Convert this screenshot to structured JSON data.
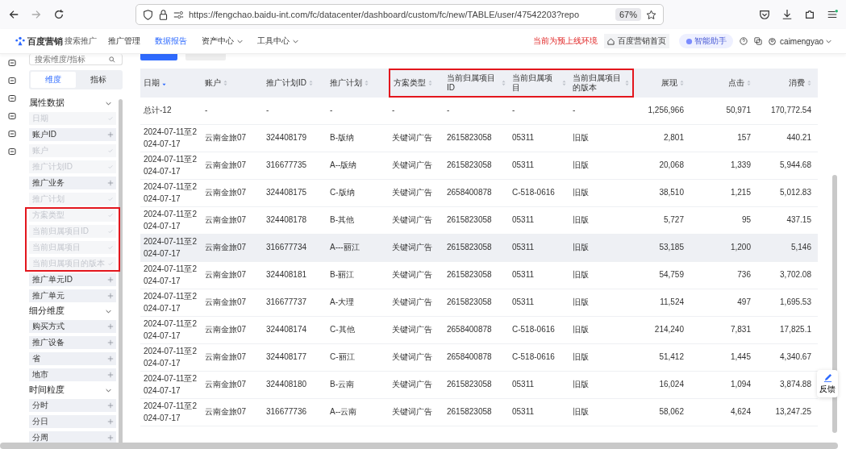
{
  "browser": {
    "url": "https://fengchao.baidu-int.com/fc/datacenter/dashboard/custom/fc/new/TABLE/user/47542203?repo",
    "zoom": "67%"
  },
  "nav": {
    "brand": "百度营销",
    "product": "搜索推广",
    "menu": [
      {
        "label": "推广管理",
        "selected": false,
        "dropdown": false
      },
      {
        "label": "数据报告",
        "selected": true,
        "dropdown": false
      },
      {
        "label": "资产中心",
        "selected": false,
        "dropdown": true
      },
      {
        "label": "工具中心",
        "selected": false,
        "dropdown": true
      }
    ],
    "env_notice": "当前为预上线环境",
    "home_link": "百度营销首页",
    "assistant": "智能助手",
    "user": "caimengyao"
  },
  "sidebar": {
    "search": {
      "placeholder": "搜索维度/指标"
    },
    "tabs": [
      {
        "label": "维度",
        "selected": true
      },
      {
        "label": "指标",
        "selected": false
      }
    ],
    "sections": [
      {
        "title": "属性数据",
        "expanded": true,
        "items": [
          {
            "label": "日期",
            "added": true,
            "highlighted": false
          },
          {
            "label": "账户ID",
            "added": false,
            "highlighted": false
          },
          {
            "label": "账户",
            "added": true,
            "highlighted": false
          },
          {
            "label": "推广计划ID",
            "added": true,
            "highlighted": false
          },
          {
            "label": "推广业务",
            "added": false,
            "highlighted": false
          },
          {
            "label": "推广计划",
            "added": true,
            "highlighted": false
          },
          {
            "label": "方案类型",
            "added": true,
            "highlighted": true
          },
          {
            "label": "当前归属项目ID",
            "added": true,
            "highlighted": true
          },
          {
            "label": "当前归属项目",
            "added": true,
            "highlighted": true
          },
          {
            "label": "当前归属项目的版本",
            "added": true,
            "highlighted": true
          },
          {
            "label": "推广单元ID",
            "added": false,
            "highlighted": false
          },
          {
            "label": "推广单元",
            "added": false,
            "highlighted": false
          }
        ]
      },
      {
        "title": "细分维度",
        "expanded": true,
        "items": [
          {
            "label": "购买方式",
            "added": false,
            "highlighted": false
          },
          {
            "label": "推广设备",
            "added": false,
            "highlighted": false
          },
          {
            "label": "省",
            "added": false,
            "highlighted": false
          },
          {
            "label": "地市",
            "added": false,
            "highlighted": false
          }
        ]
      },
      {
        "title": "时间粒度",
        "expanded": true,
        "items": [
          {
            "label": "分时",
            "added": false,
            "highlighted": false
          },
          {
            "label": "分日",
            "added": false,
            "highlighted": false
          },
          {
            "label": "分周",
            "added": false,
            "highlighted": false
          }
        ]
      }
    ]
  },
  "table": {
    "columns": [
      {
        "label": "日期",
        "kind": "text",
        "sorted": true,
        "highlighted": false
      },
      {
        "label": "账户",
        "kind": "text",
        "sorted": false,
        "highlighted": false
      },
      {
        "label": "推广计划ID",
        "kind": "text",
        "sorted": false,
        "highlighted": false
      },
      {
        "label": "推广计划",
        "kind": "text",
        "sorted": false,
        "highlighted": false
      },
      {
        "label": "方案类型",
        "kind": "text",
        "sorted": false,
        "highlighted": true
      },
      {
        "label": "当前归属项目ID",
        "kind": "text",
        "sorted": false,
        "highlighted": true
      },
      {
        "label": "当前归属项目",
        "kind": "text",
        "sorted": false,
        "highlighted": true
      },
      {
        "label": "当前归属项目的版本",
        "kind": "text",
        "sorted": false,
        "highlighted": true
      },
      {
        "label": "展现",
        "kind": "number",
        "sorted": false,
        "highlighted": false
      },
      {
        "label": "点击",
        "kind": "number",
        "sorted": false,
        "highlighted": false
      },
      {
        "label": "消费",
        "kind": "number",
        "sorted": false,
        "highlighted": false
      }
    ],
    "total": [
      "总计-12",
      "-",
      "-",
      "-",
      "-",
      "-",
      "-",
      "-",
      "1,256,966",
      "50,971",
      "170,772.54"
    ],
    "rows": [
      {
        "highlighted": false,
        "cells": [
          "2024-07-11至2024-07-17",
          "云南金旅07",
          "324408179",
          "B-版纳",
          "关键词广告",
          "2615823058",
          "05311",
          "旧版",
          "2,801",
          "157",
          "440.21"
        ]
      },
      {
        "highlighted": false,
        "cells": [
          "2024-07-11至2024-07-17",
          "云南金旅07",
          "316677735",
          "A--版纳",
          "关键词广告",
          "2615823058",
          "05311",
          "旧版",
          "20,068",
          "1,339",
          "5,944.68"
        ]
      },
      {
        "highlighted": false,
        "cells": [
          "2024-07-11至2024-07-17",
          "云南金旅07",
          "324408175",
          "C-版纳",
          "关键词广告",
          "2658400878",
          "C-518-0616",
          "旧版",
          "38,510",
          "1,215",
          "5,012.83"
        ]
      },
      {
        "highlighted": false,
        "cells": [
          "2024-07-11至2024-07-17",
          "云南金旅07",
          "324408178",
          "B-其他",
          "关键词广告",
          "2615823058",
          "05311",
          "旧版",
          "5,727",
          "95",
          "437.15"
        ]
      },
      {
        "highlighted": true,
        "cells": [
          "2024-07-11至2024-07-17",
          "云南金旅07",
          "316677734",
          "A---丽江",
          "关键词广告",
          "2615823058",
          "05311",
          "旧版",
          "53,185",
          "1,200",
          "5,146"
        ]
      },
      {
        "highlighted": false,
        "cells": [
          "2024-07-11至2024-07-17",
          "云南金旅07",
          "324408181",
          "B-丽江",
          "关键词广告",
          "2615823058",
          "05311",
          "旧版",
          "54,759",
          "736",
          "3,702.08"
        ]
      },
      {
        "highlighted": false,
        "cells": [
          "2024-07-11至2024-07-17",
          "云南金旅07",
          "316677737",
          "A-大理",
          "关键词广告",
          "2615823058",
          "05311",
          "旧版",
          "11,524",
          "497",
          "1,695.53"
        ]
      },
      {
        "highlighted": false,
        "cells": [
          "2024-07-11至2024-07-17",
          "云南金旅07",
          "324408174",
          "C-其他",
          "关键词广告",
          "2658400878",
          "C-518-0616",
          "旧版",
          "214,240",
          "7,831",
          "17,825.1"
        ]
      },
      {
        "highlighted": false,
        "cells": [
          "2024-07-11至2024-07-17",
          "云南金旅07",
          "324408177",
          "C-丽江",
          "关键词广告",
          "2658400878",
          "C-518-0616",
          "旧版",
          "51,412",
          "1,445",
          "4,340.67"
        ]
      },
      {
        "highlighted": false,
        "cells": [
          "2024-07-11至2024-07-17",
          "云南金旅07",
          "324408180",
          "B-云南",
          "关键词广告",
          "2615823058",
          "05311",
          "旧版",
          "16,024",
          "1,094",
          "3,874.88"
        ]
      },
      {
        "highlighted": false,
        "cells": [
          "2024-07-11至2024-07-17",
          "云南金旅07",
          "316677736",
          "A--云南",
          "关键词广告",
          "2615823058",
          "05311",
          "旧版",
          "58,062",
          "4,624",
          "13,247.25"
        ]
      }
    ]
  },
  "feedback": "反馈"
}
